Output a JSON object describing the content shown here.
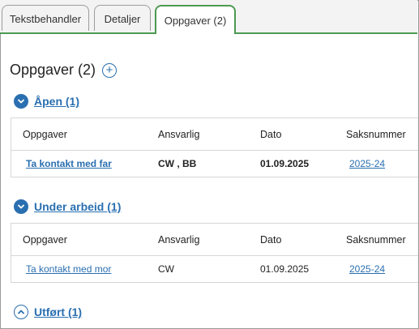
{
  "tabs": [
    {
      "label": "Tekstbehandler",
      "active": false
    },
    {
      "label": "Detaljer",
      "active": false
    },
    {
      "label": "Oppgaver (2)",
      "active": true
    }
  ],
  "page": {
    "title": "Oppgaver (2)",
    "add_icon": "plus-circle-icon"
  },
  "columns": [
    "Oppgaver",
    "Ansvarlig",
    "Dato",
    "Saksnummer"
  ],
  "sections": [
    {
      "label": "Åpen (1)",
      "expanded": true,
      "rows": [
        {
          "task": "Ta kontakt med far",
          "responsible": "CW , BB",
          "date": "01.09.2025",
          "case": "2025-24"
        }
      ]
    },
    {
      "label": "Under arbeid (1)",
      "expanded": true,
      "rows": [
        {
          "task": "Ta kontakt med mor",
          "responsible": "CW",
          "date": "01.09.2025",
          "case": "2025-24"
        }
      ]
    },
    {
      "label": "Utført (1)",
      "expanded": false
    }
  ],
  "colors": {
    "accent": "#2a6fb0",
    "tab_active_border": "#4c9a52"
  }
}
